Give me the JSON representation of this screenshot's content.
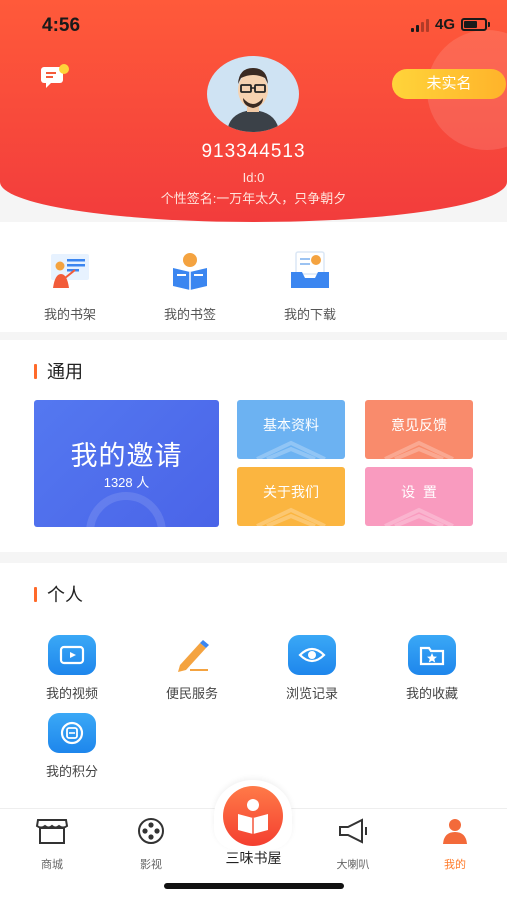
{
  "status_bar": {
    "time": "4:56",
    "network": "4G"
  },
  "profile": {
    "verify_label": "未实名",
    "user_name": "913344513",
    "user_id": "Id:0",
    "signature": "个性签名:一万年太久，只争朝夕"
  },
  "quick_actions": [
    {
      "label": "我的书架",
      "icon": "bookshelf-icon"
    },
    {
      "label": "我的书签",
      "icon": "bookmark-reader-icon"
    },
    {
      "label": "我的下载",
      "icon": "download-tray-icon"
    }
  ],
  "general": {
    "title": "通用",
    "invite": {
      "title": "我的邀请",
      "count": "1328 人"
    },
    "tiles": [
      {
        "label": "基本资料",
        "color": "#6cb2f2"
      },
      {
        "label": "意见反馈",
        "color": "#f98b6c"
      },
      {
        "label": "关于我们",
        "color": "#fbb540"
      },
      {
        "label": "设  置",
        "color": "#f99bbf"
      }
    ]
  },
  "personal": {
    "title": "个人",
    "items": [
      {
        "label": "我的视频",
        "icon": "video-icon"
      },
      {
        "label": "便民服务",
        "icon": "pencil-icon"
      },
      {
        "label": "浏览记录",
        "icon": "eye-icon"
      },
      {
        "label": "我的收藏",
        "icon": "star-folder-icon"
      },
      {
        "label": "我的积分",
        "icon": "points-icon"
      }
    ]
  },
  "tabbar": {
    "tabs": [
      {
        "label": "商城",
        "icon": "shop-icon"
      },
      {
        "label": "影视",
        "icon": "film-reel-icon"
      },
      {
        "label": "大喇叭",
        "icon": "megaphone-icon"
      },
      {
        "label": "我的",
        "icon": "user-icon"
      }
    ],
    "center_label": "三味书屋",
    "active_tab": "我的",
    "accent_color": "#ff7b2a"
  }
}
